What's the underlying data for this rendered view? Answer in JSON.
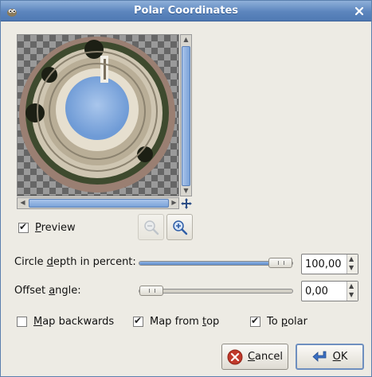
{
  "window": {
    "title": "Polar Coordinates"
  },
  "icons": {
    "app": "gimp-wilber-icon",
    "close": "close-icon",
    "navigate": "navigate-crosshair-icon",
    "zoom_out": "zoom-out-icon",
    "zoom_in": "zoom-in-icon",
    "cancel": "cancel-icon",
    "ok": "ok-arrow-icon"
  },
  "preview": {
    "label_access": "P",
    "label_rest": "review",
    "checked": true
  },
  "controls": {
    "circle_depth": {
      "label_pre": "Circle ",
      "label_access": "d",
      "label_post": "epth in percent:",
      "value": "100,00",
      "level": 1.0
    },
    "offset_angle": {
      "label_pre": "Offset ",
      "label_access": "a",
      "label_post": "ngle:",
      "value": "0,00",
      "level": 0.0
    }
  },
  "options": {
    "map_backwards": {
      "label_access": "M",
      "label_rest": "ap backwards",
      "checked": false
    },
    "map_from_top": {
      "label_pre": "Map from ",
      "label_access": "t",
      "label_post": "op",
      "checked": true
    },
    "to_polar": {
      "label_pre": "To ",
      "label_access": "p",
      "label_post": "olar",
      "checked": true
    }
  },
  "buttons": {
    "cancel": {
      "label_access": "C",
      "label_rest": "ancel"
    },
    "ok": {
      "label_access": "O",
      "label_rest": "K"
    }
  },
  "colors": {
    "titlebar": "#5c85bd",
    "accent": "#7aa2d8",
    "cancel_icon": "#c0392b",
    "ok_icon": "#3b6fc2"
  }
}
